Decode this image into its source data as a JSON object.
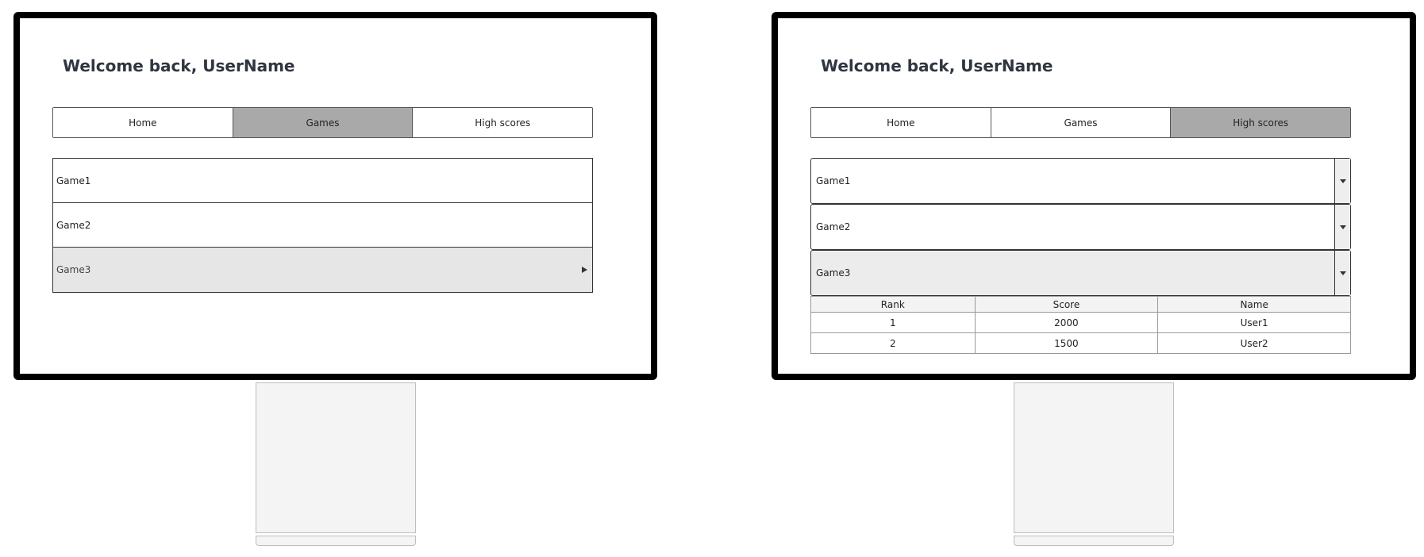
{
  "left_screen": {
    "welcome": "Welcome back, UserName",
    "tabs": [
      {
        "label": "Home"
      },
      {
        "label": "Games"
      },
      {
        "label": "High scores"
      }
    ],
    "games": [
      {
        "label": "Game1"
      },
      {
        "label": "Game2"
      },
      {
        "label": "Game3"
      }
    ]
  },
  "right_screen": {
    "welcome": "Welcome back, UserName",
    "tabs": [
      {
        "label": "Home"
      },
      {
        "label": "Games"
      },
      {
        "label": "High scores"
      }
    ],
    "games": [
      {
        "label": "Game1"
      },
      {
        "label": "Game2"
      },
      {
        "label": "Game3"
      }
    ],
    "table": {
      "headers": [
        "Rank",
        "Score",
        "Name"
      ],
      "rows": [
        [
          "1",
          "2000",
          "User1"
        ],
        [
          "2",
          "1500",
          "User2"
        ]
      ]
    }
  },
  "icons": {
    "selected_arrow": "caret-right-icon",
    "expand": "caret-down-icon"
  },
  "colors": {
    "active_tab": "#a9a9a9",
    "selected_row": "#e6e6e6",
    "frame": "#000000"
  }
}
